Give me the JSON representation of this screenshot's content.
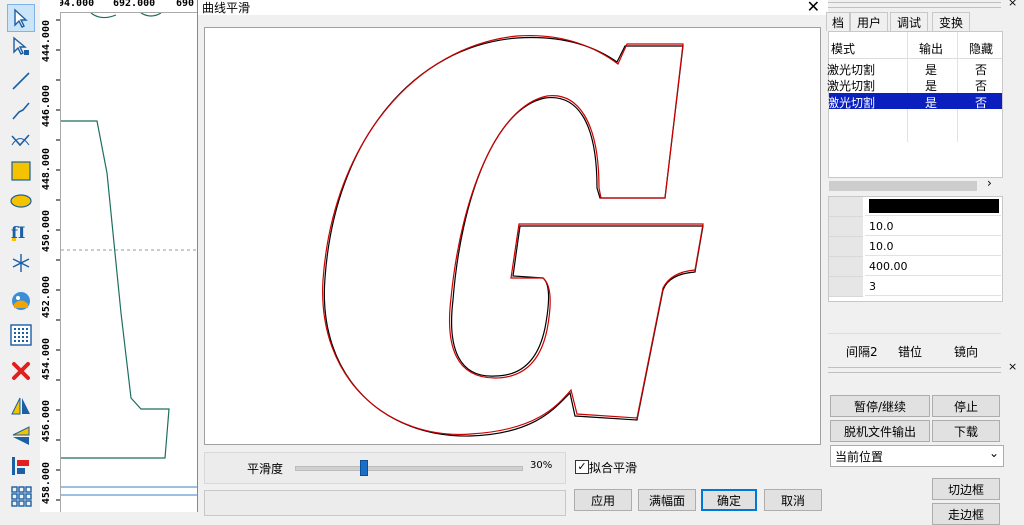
{
  "toolbar": {
    "tools": [
      "select-arrow-icon",
      "node-edit-icon",
      "line-icon",
      "polyline-icon",
      "bezier-icon",
      "rectangle-icon",
      "ellipse-icon",
      "text-icon",
      "star-icon",
      "bitmap-icon",
      "array-icon",
      "delete-icon",
      "mirror-horizontal-icon",
      "mirror-vertical-icon",
      "align-icon",
      "grid-icon"
    ]
  },
  "rulers": {
    "horizontal": [
      "94.000",
      "692.000",
      "690"
    ],
    "vertical": [
      "444.000",
      "446.000",
      "448.000",
      "450.000",
      "452.000",
      "454.000",
      "456.000",
      "458.000"
    ]
  },
  "dialog": {
    "title": "曲线平滑",
    "slider_label": "平滑度",
    "slider_value": "30%",
    "slider_fraction": 0.3,
    "checkbox_label": "拟合平滑",
    "checkbox_checked": true,
    "buttons": {
      "apply": "应用",
      "fit": "满幅面",
      "ok": "确定",
      "cancel": "取消"
    },
    "colors": {
      "original_curve": "#000000",
      "smoothed_curve": "#cc0000"
    }
  },
  "right_panel": {
    "tabs": [
      "档",
      "用户",
      "调试",
      "变换"
    ],
    "table_headers": [
      "模式",
      "输出",
      "隐藏"
    ],
    "rows": [
      {
        "mode": "激光切割",
        "output": "是",
        "hidden": "否",
        "selected": false
      },
      {
        "mode": "激光切割",
        "output": "是",
        "hidden": "否",
        "selected": false
      },
      {
        "mode": "激光切割",
        "output": "是",
        "hidden": "否",
        "selected": true
      }
    ],
    "props": [
      "10.0",
      "10.0",
      "400.00",
      "3"
    ],
    "props_color": "#000000",
    "labels": [
      "间隔2",
      "错位",
      "镜向"
    ],
    "buttons": {
      "pause": "暂停/继续",
      "stop": "停止",
      "offline": "脱机文件输出",
      "download": "下载",
      "cut_frame": "切边框",
      "walk_frame": "走边框"
    },
    "position_select": "当前位置"
  }
}
